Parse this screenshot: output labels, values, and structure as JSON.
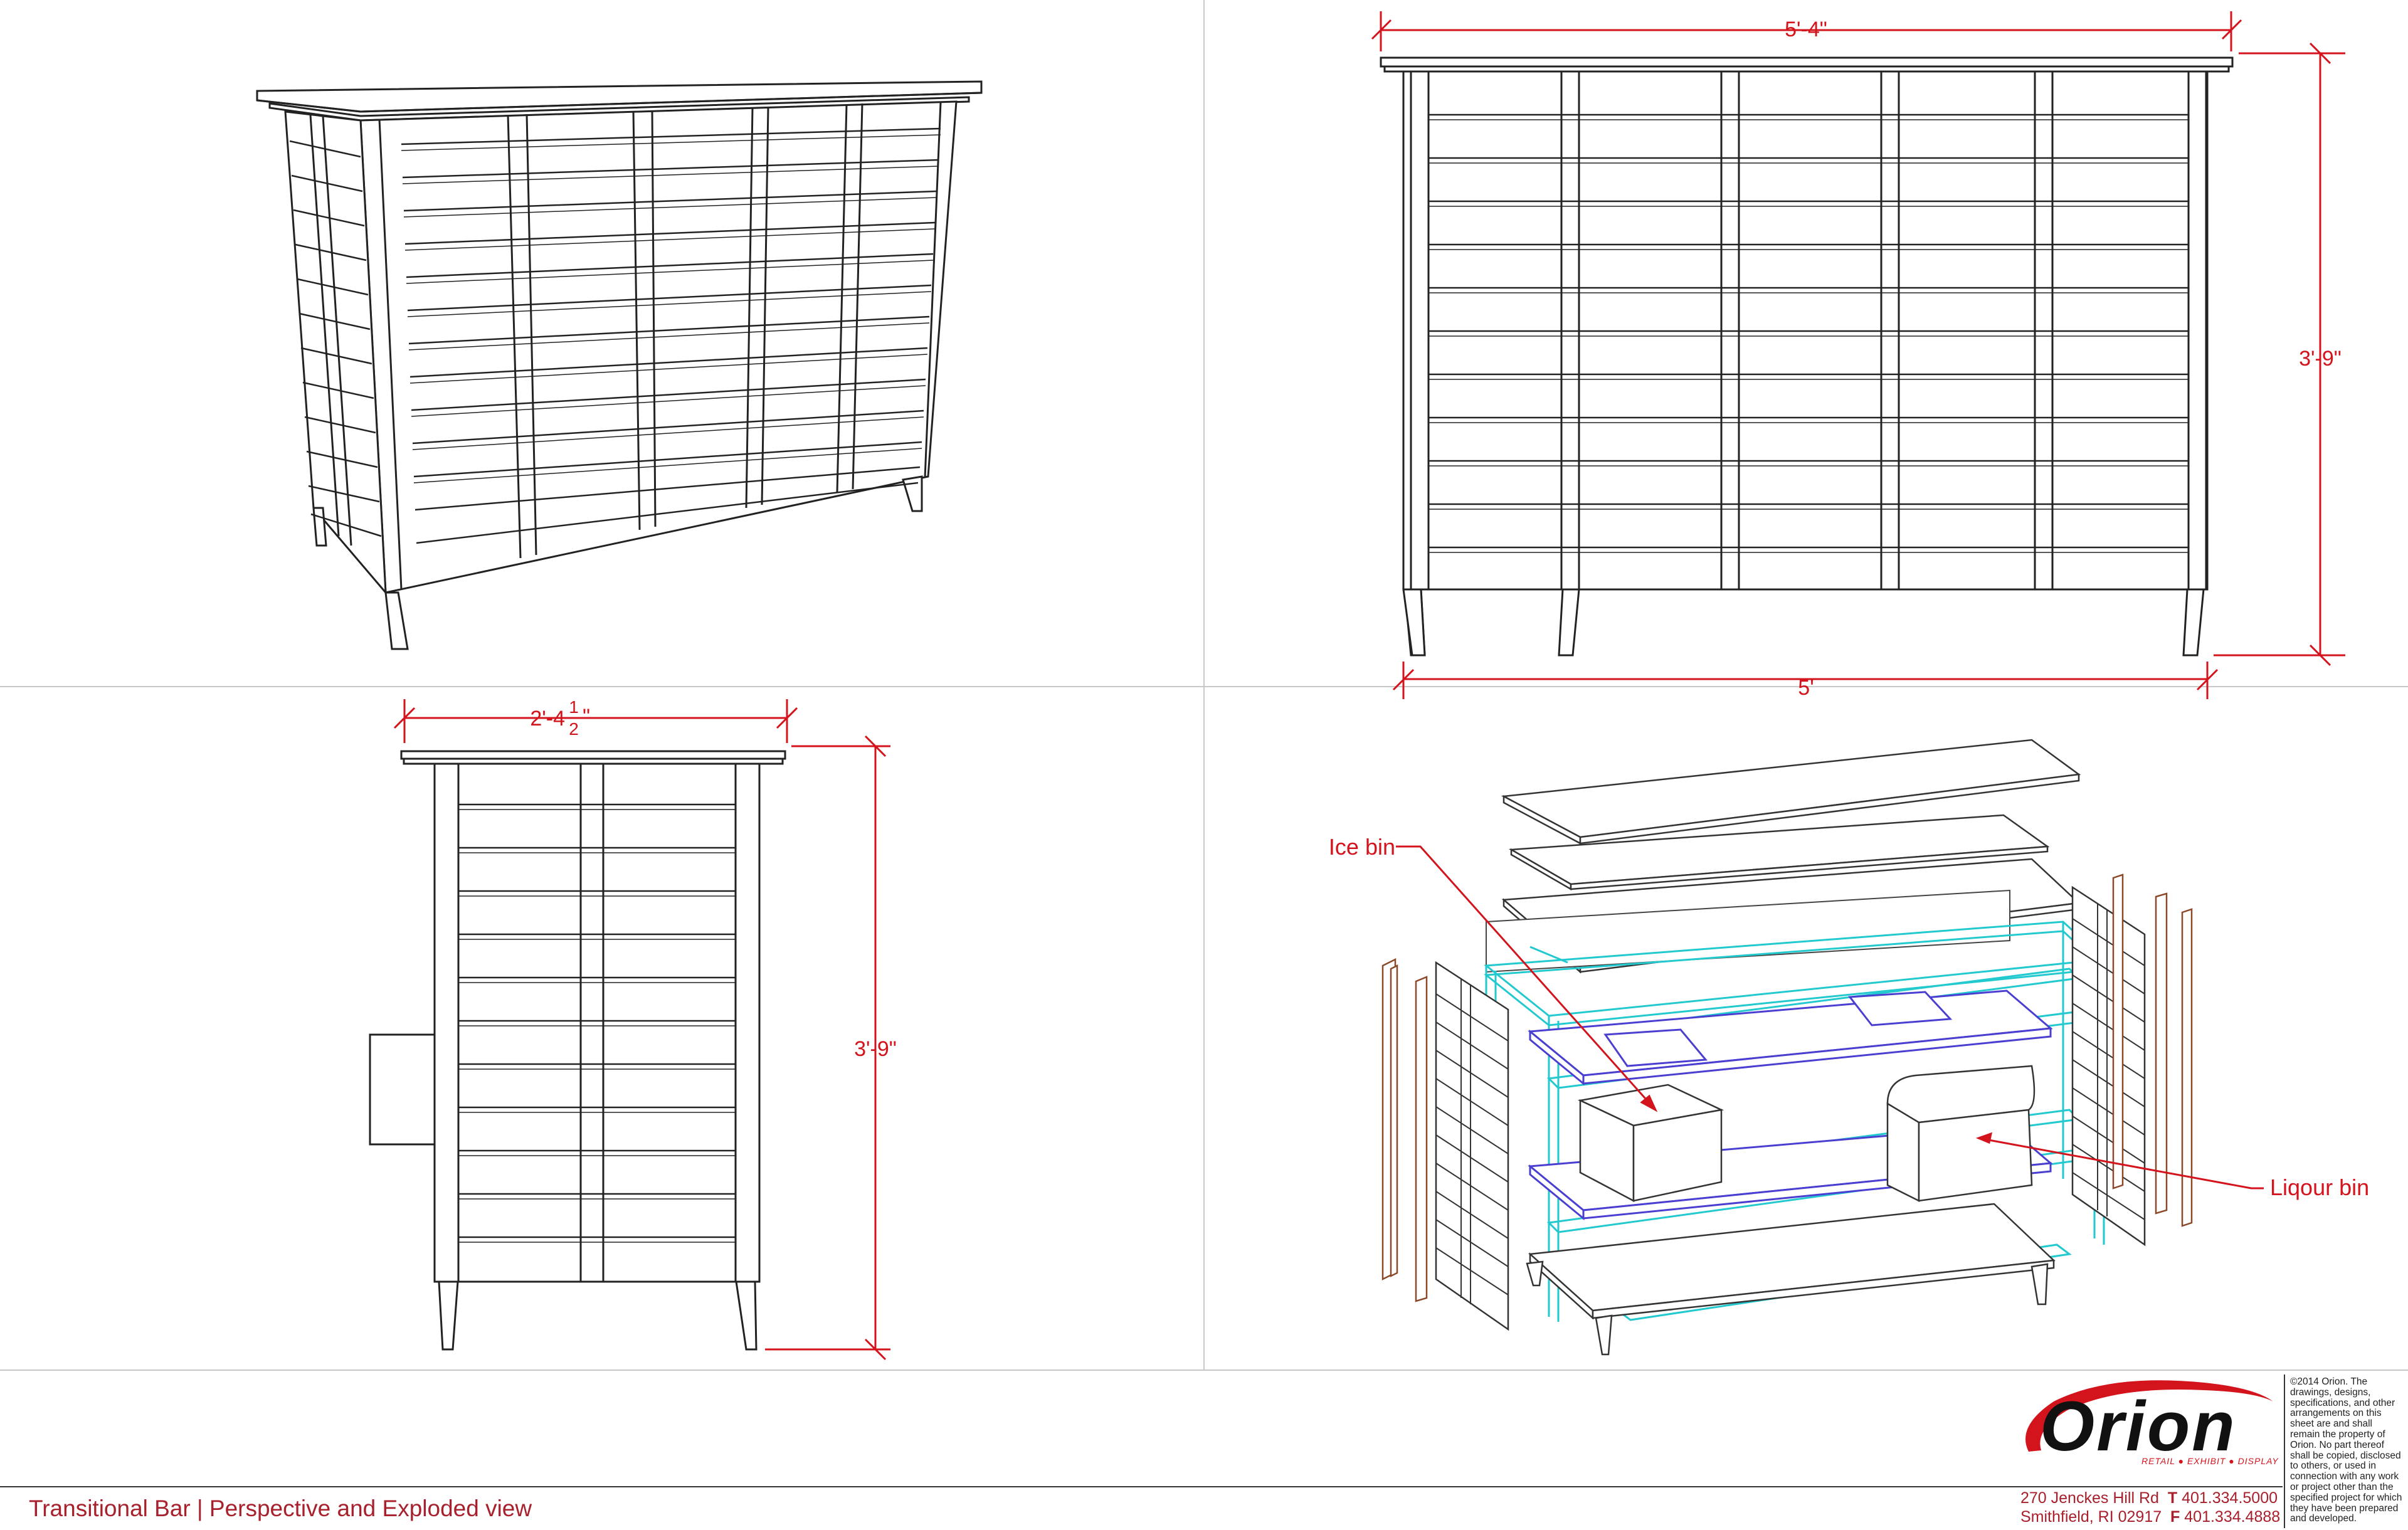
{
  "sheet": {
    "title": "Transitional Bar | Perspective and Exploded view",
    "dimensions": {
      "front_top_width": "5'-4\"",
      "front_base_width": "5'",
      "front_height": "3'-9\"",
      "side_width_whole": "2'-4",
      "side_width_num": "1",
      "side_width_den": "2",
      "side_width_inch": "\"",
      "side_height": "3'-9\""
    },
    "callouts": {
      "ice_bin": "Ice bin",
      "liquor_bin": "Liqour bin"
    }
  },
  "company": {
    "name": "Orion",
    "tagline": "Retail • Exhibit • Display",
    "address_line1": "270 Jenckes Hill Rd",
    "phone_label": "T",
    "phone": "401.334.5000",
    "address_line2": "Smithfield, RI 02917",
    "fax_label": "F",
    "fax": "401.334.4888",
    "copyright": "©2014 Orion. The drawings, designs, specifications, and other arrangements on this sheet are and shall remain the property of Orion.  No part thereof shall be copied, disclosed to others, or used in connection with any work or project other than the specified project for which they have been prepared and developed.",
    "brand_color": "#d4141c"
  }
}
